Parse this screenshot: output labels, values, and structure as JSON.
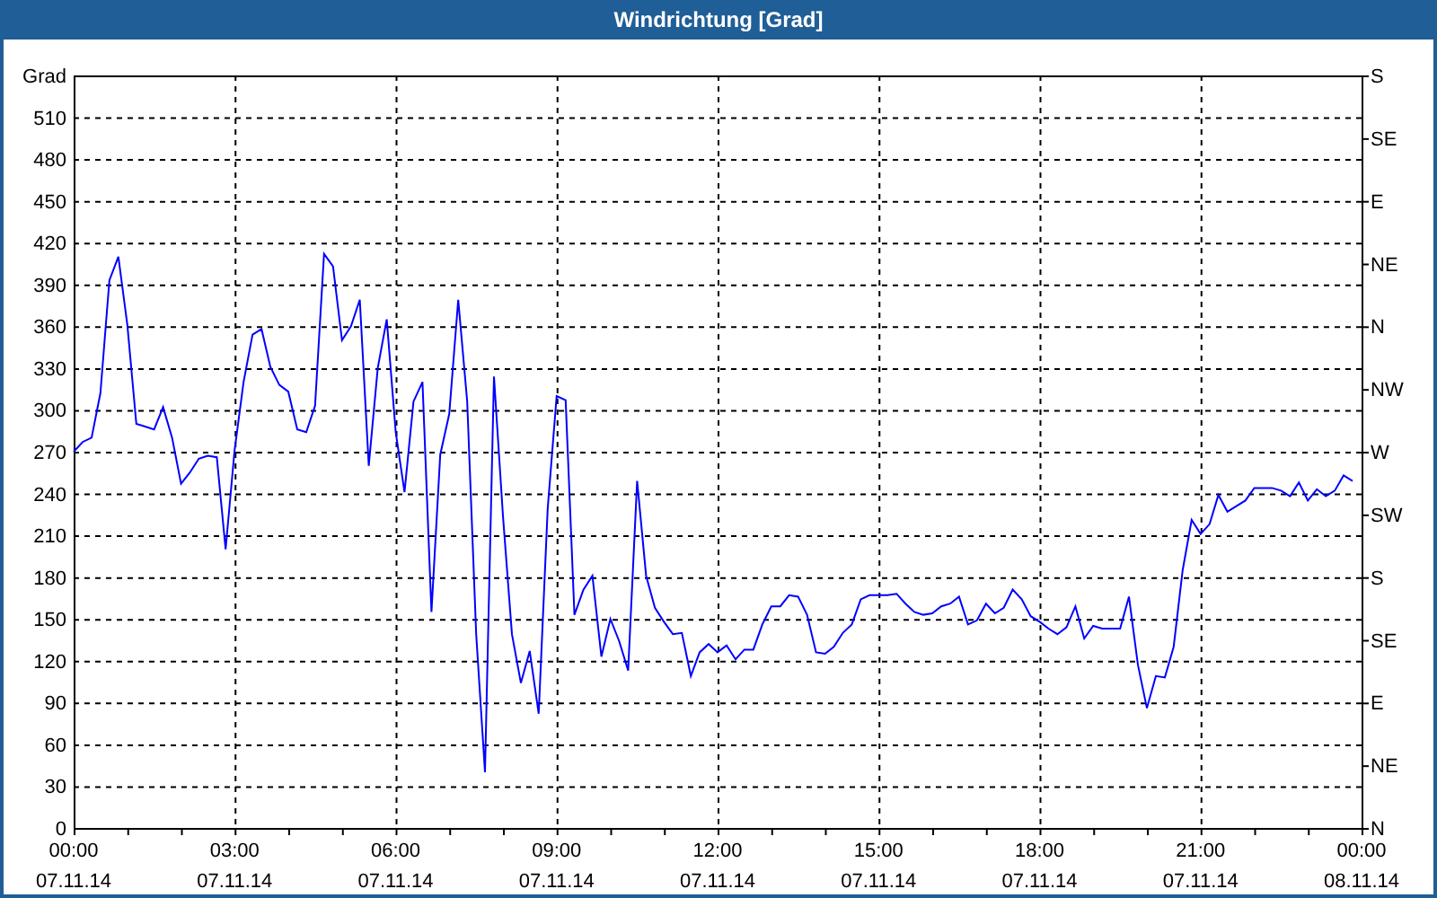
{
  "window": {
    "title": "Windrichtung [Grad]"
  },
  "chart": {
    "chart_data": {
      "type": "line",
      "grid": true,
      "ylabel": "Grad",
      "ylim": [
        0,
        540
      ],
      "categories": [
        "00:00 07.11.14",
        null,
        null,
        null,
        null,
        null,
        null,
        null,
        null,
        null,
        null,
        null,
        null,
        null,
        null,
        null,
        null,
        null,
        "03:00 07.11.14",
        null,
        null,
        null,
        null,
        null,
        null,
        null,
        null,
        null,
        null,
        null,
        null,
        null,
        null,
        null,
        null,
        null,
        "06:00 07.11.14",
        null,
        null,
        null,
        null,
        null,
        null,
        null,
        null,
        null,
        null,
        null,
        null,
        null,
        null,
        null,
        null,
        null,
        "09:00 07.11.14",
        null,
        null,
        null,
        null,
        null,
        null,
        null,
        null,
        null,
        null,
        null,
        null,
        null,
        null,
        null,
        null,
        null,
        "12:00 07.11.14",
        null,
        null,
        null,
        null,
        null,
        null,
        null,
        null,
        null,
        null,
        null,
        null,
        null,
        null,
        null,
        null,
        null,
        "15:00 07.11.14",
        null,
        null,
        null,
        null,
        null,
        null,
        null,
        null,
        null,
        null,
        null,
        null,
        null,
        null,
        null,
        null,
        null,
        "18:00 07.11.14",
        null,
        null,
        null,
        null,
        null,
        null,
        null,
        null,
        null,
        null,
        null,
        null,
        null,
        null,
        null,
        null,
        null,
        "21:00 07.11.14",
        null,
        null,
        null,
        null,
        null,
        null,
        null,
        null,
        null,
        null,
        null,
        null,
        null,
        null,
        null,
        null,
        null,
        "00:00 08.11.14"
      ],
      "yticks": [
        0,
        30,
        60,
        90,
        120,
        150,
        180,
        210,
        240,
        270,
        300,
        330,
        360,
        390,
        420,
        450,
        480,
        510
      ],
      "values": [
        270,
        277,
        280,
        312,
        393,
        410,
        361,
        290,
        288,
        286,
        302,
        280,
        247,
        255,
        265,
        267,
        266,
        200,
        271,
        320,
        354,
        358,
        331,
        318,
        313,
        286,
        284,
        303,
        412,
        403,
        350,
        360,
        379,
        260,
        330,
        365,
        284,
        241,
        306,
        320,
        155,
        268,
        297,
        379,
        306,
        139,
        40,
        324,
        224,
        139,
        104,
        127,
        82,
        229,
        310,
        307,
        153,
        171,
        181,
        123,
        150,
        134,
        113,
        249,
        181,
        158,
        148,
        139,
        140,
        109,
        126,
        132,
        126,
        131,
        121,
        128,
        128,
        146,
        159,
        159,
        167,
        166,
        153,
        126,
        125,
        130,
        140,
        146,
        164,
        167,
        167,
        167,
        168,
        161,
        155,
        153,
        154,
        159,
        161,
        166,
        146,
        149,
        161,
        154,
        158,
        171,
        164,
        152,
        148,
        143,
        139,
        144,
        159,
        136,
        145,
        143,
        143,
        143,
        166,
        117,
        86,
        109,
        108,
        130,
        185,
        221,
        211,
        218,
        239,
        227,
        231,
        235,
        244,
        244,
        244,
        242,
        238,
        248,
        235,
        243,
        238,
        242,
        253,
        249,
        null
      ]
    },
    "compass_axis": [
      "S",
      "SE",
      "E",
      "NE",
      "N",
      "NW",
      "W",
      "SW",
      "S",
      "SE",
      "E",
      "NE",
      "N"
    ]
  }
}
